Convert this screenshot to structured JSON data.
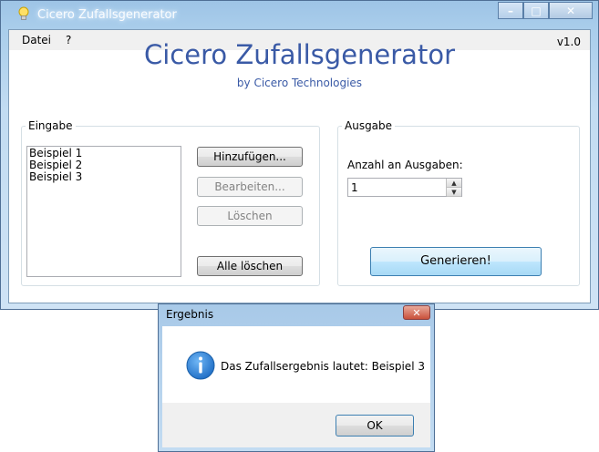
{
  "window": {
    "title": "Cicero Zufallsgenerator",
    "caption_buttons": {
      "minimize": "–",
      "maximize": "□",
      "close": "✕"
    }
  },
  "menu": {
    "items": [
      "Datei",
      "?"
    ],
    "version": "v1.0"
  },
  "header": {
    "title": "Cicero Zufallsgenerator",
    "subtitle": "by Cicero Technologies"
  },
  "eingabe": {
    "label": "Eingabe",
    "items": [
      "Beispiel 1",
      "Beispiel 2",
      "Beispiel 3"
    ],
    "buttons": {
      "add": "Hinzufügen...",
      "edit": "Bearbeiten...",
      "delete": "Löschen",
      "delete_all": "Alle löschen"
    }
  },
  "ausgabe": {
    "label": "Ausgabe",
    "count_label": "Anzahl an Ausgaben:",
    "count_value": "1",
    "generate": "Generieren!"
  },
  "dialog": {
    "title": "Ergebnis",
    "close": "✕",
    "message": "Das Zufallsergebnis lautet:  Beispiel 3",
    "ok": "OK",
    "icon": "info-icon"
  },
  "colors": {
    "heading": "#3a5aa6",
    "accent_button": "#3c7fb1",
    "info_icon": "#1d7bd6"
  }
}
